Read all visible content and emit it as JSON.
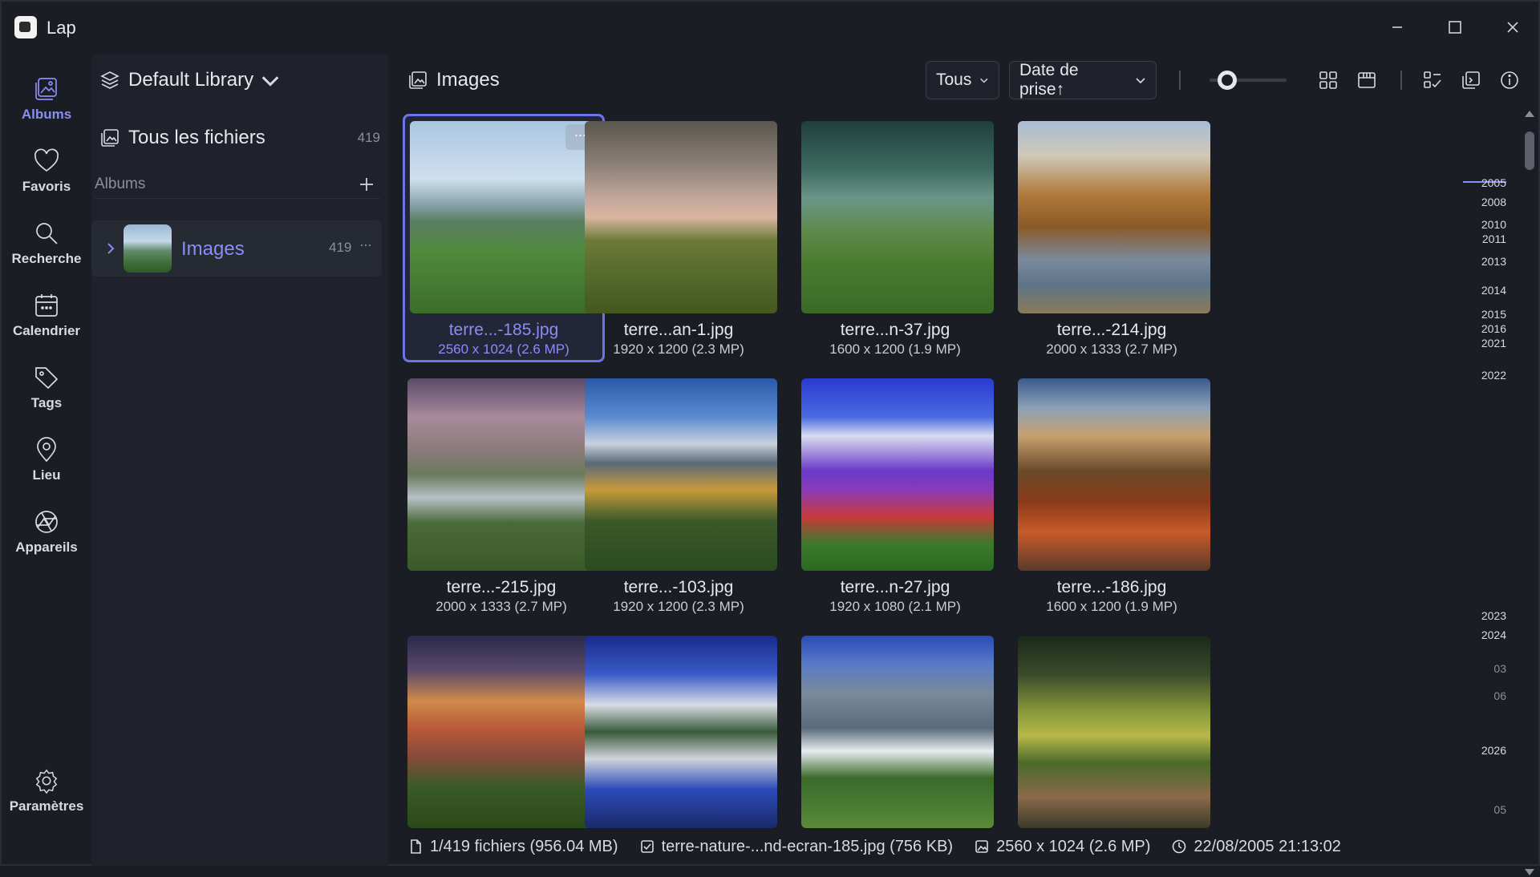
{
  "app": {
    "title": "Lap"
  },
  "nav": {
    "items": [
      {
        "label": "Albums",
        "icon": "albums-icon",
        "active": true
      },
      {
        "label": "Favoris",
        "icon": "heart-icon"
      },
      {
        "label": "Recherche",
        "icon": "search-icon"
      },
      {
        "label": "Calendrier",
        "icon": "calendar-icon"
      },
      {
        "label": "Tags",
        "icon": "tag-icon"
      },
      {
        "label": "Lieu",
        "icon": "location-pin-icon"
      },
      {
        "label": "Appareils",
        "icon": "camera-aperture-icon"
      }
    ],
    "settings_label": "Paramètres"
  },
  "library": {
    "name": "Default Library",
    "all_files_label": "Tous les fichiers",
    "all_files_count": "419",
    "albums_header": "Albums",
    "albums": [
      {
        "name": "Images",
        "count": "419",
        "more": "···"
      }
    ]
  },
  "main": {
    "title": "Images",
    "filter_value": "Tous",
    "sort_value": "Date de prise↑"
  },
  "images": [
    {
      "name": "terre...-185.jpg",
      "dims": "2560 x 1024 (2.6 MP)",
      "selected": true
    },
    {
      "name": "terre...an-1.jpg",
      "dims": "1920 x 1200 (2.3 MP)"
    },
    {
      "name": "terre...n-37.jpg",
      "dims": "1600 x 1200 (1.9 MP)"
    },
    {
      "name": "terre...-214.jpg",
      "dims": "2000 x 1333 (2.7 MP)"
    },
    {
      "name": "terre...-215.jpg",
      "dims": "2000 x 1333 (2.7 MP)"
    },
    {
      "name": "terre...-103.jpg",
      "dims": "1920 x 1200 (2.3 MP)"
    },
    {
      "name": "terre...n-27.jpg",
      "dims": "1920 x 1080 (2.1 MP)"
    },
    {
      "name": "terre...-186.jpg",
      "dims": "1600 x 1200 (1.9 MP)"
    },
    {
      "name": "",
      "dims": ""
    },
    {
      "name": "",
      "dims": ""
    },
    {
      "name": "",
      "dims": ""
    },
    {
      "name": "",
      "dims": ""
    }
  ],
  "more_label": "···",
  "timeline": {
    "labels": [
      "2005",
      "2008",
      "2010",
      "2011",
      "2013",
      "2014",
      "2015",
      "2016",
      "2021",
      "2022",
      "2023",
      "2024",
      "03",
      "06",
      "2026",
      "05"
    ]
  },
  "status": {
    "files": "1/419 fichiers (956.04 MB)",
    "selected_file": "terre-nature-...nd-ecran-185.jpg (756 KB)",
    "dimensions": "2560 x 1024 (2.6 MP)",
    "date": "22/08/2005 21:13:02"
  },
  "colors": {
    "accent": "#8a8df6",
    "background": "#1b1d24",
    "panel": "#1f222a"
  }
}
